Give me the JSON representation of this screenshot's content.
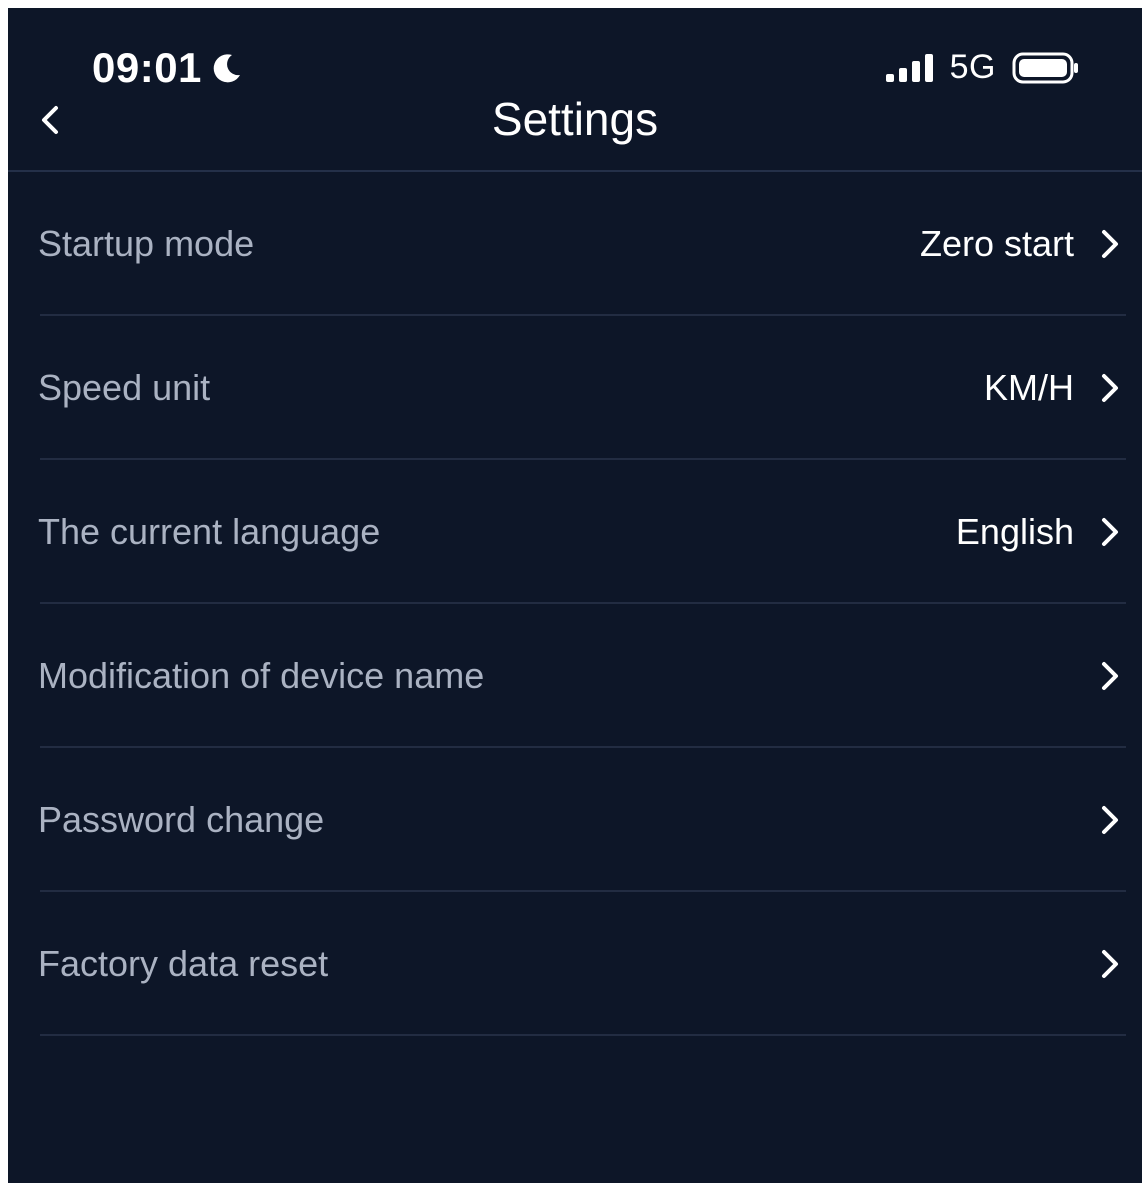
{
  "status_bar": {
    "time": "09:01",
    "network": "5G",
    "icons": [
      "moon-icon",
      "signal-icon",
      "battery-icon"
    ]
  },
  "nav": {
    "title": "Settings",
    "back_icon": "chevron-left-icon"
  },
  "settings": {
    "items": [
      {
        "label": "Startup mode",
        "value": "Zero start"
      },
      {
        "label": "Speed unit",
        "value": "KM/H"
      },
      {
        "label": "The current language",
        "value": "English"
      },
      {
        "label": "Modification of device name",
        "value": ""
      },
      {
        "label": "Password change",
        "value": ""
      },
      {
        "label": "Factory data reset",
        "value": ""
      }
    ]
  },
  "colors": {
    "background": "#0d1628",
    "label_text": "#aab2c2",
    "value_text": "#ffffff",
    "divider": "#222c42"
  }
}
